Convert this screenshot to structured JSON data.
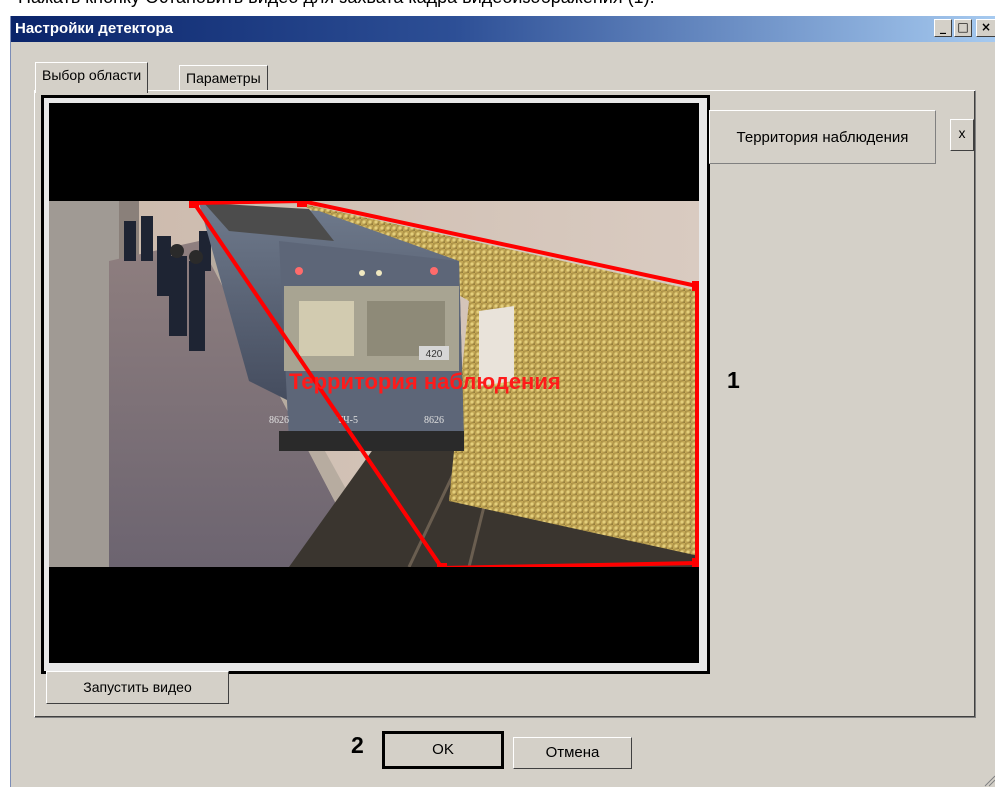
{
  "page_caption": "Нажать кнопку Остановить видео для захвата кадра видеоизображения (1).",
  "window": {
    "title": "Настройки детектора",
    "controls": {
      "minimize": "_",
      "maximize": "□",
      "close": "×"
    }
  },
  "tabs": [
    {
      "label": "Выбор области",
      "active": true
    },
    {
      "label": "Параметры",
      "active": false
    }
  ],
  "video": {
    "zone_label": "Территория наблюдения",
    "zone_color": "#ff0000",
    "train_numbers": {
      "left": "8626",
      "center": "ТЧ-5",
      "right": "8626",
      "route": "420"
    }
  },
  "zone_list": {
    "item_label": "Территория наблюдения",
    "delete_label": "x"
  },
  "buttons": {
    "start_video": "Запустить видео",
    "ok": "OK",
    "cancel": "Отмена"
  },
  "callouts": {
    "video_area": "1",
    "ok_button": "2"
  },
  "colors": {
    "titlebar_start": "#0a246a",
    "titlebar_end": "#a6caf0",
    "dialog_bg": "#d4d0c8"
  }
}
